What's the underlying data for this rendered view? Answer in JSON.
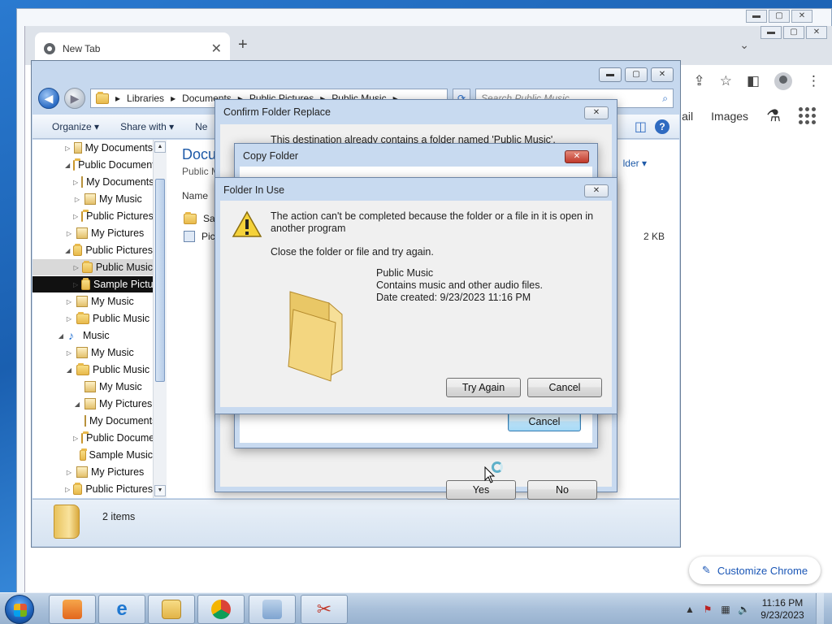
{
  "chrome": {
    "tab_title": "New Tab",
    "links": [
      "ail",
      "Images"
    ],
    "customize_label": "Customize Chrome"
  },
  "explorer": {
    "breadcrumb": [
      "Libraries",
      "Documents",
      "Public Pictures",
      "Public Music"
    ],
    "search_placeholder": "Search Public Music",
    "cmd": {
      "organize": "Organize ▾",
      "share": "Share with ▾",
      "new": "Ne"
    },
    "tree": [
      {
        "label": "My Documents",
        "indent": 1,
        "arrow": "▷",
        "icon": "lib"
      },
      {
        "label": "Public Documents",
        "indent": 1,
        "arrow": "◢",
        "icon": "folder"
      },
      {
        "label": "My Documents",
        "indent": 2,
        "arrow": "▷",
        "icon": "lib"
      },
      {
        "label": "My Music",
        "indent": 2,
        "arrow": "▷",
        "icon": "lib"
      },
      {
        "label": "Public Pictures",
        "indent": 2,
        "arrow": "▷",
        "icon": "folder"
      },
      {
        "label": "My Pictures",
        "indent": 1,
        "arrow": "▷",
        "icon": "lib"
      },
      {
        "label": "Public Pictures",
        "indent": 1,
        "arrow": "◢",
        "icon": "folder"
      },
      {
        "label": "Public Music",
        "indent": 2,
        "arrow": "▷",
        "icon": "folder",
        "state": "sel"
      },
      {
        "label": "Sample Pictures",
        "indent": 2,
        "arrow": "▷",
        "icon": "folder",
        "state": "hl"
      },
      {
        "label": "My Music",
        "indent": 1,
        "arrow": "▷",
        "icon": "lib"
      },
      {
        "label": "Public Music",
        "indent": 1,
        "arrow": "▷",
        "icon": "folder"
      },
      {
        "label": "Music",
        "indent": 0,
        "arrow": "◢",
        "icon": "music"
      },
      {
        "label": "My Music",
        "indent": 1,
        "arrow": "▷",
        "icon": "lib"
      },
      {
        "label": "Public Music",
        "indent": 1,
        "arrow": "◢",
        "icon": "folder"
      },
      {
        "label": "My Music",
        "indent": 2,
        "arrow": "",
        "icon": "lib"
      },
      {
        "label": "My Pictures",
        "indent": 2,
        "arrow": "◢",
        "icon": "lib"
      },
      {
        "label": "My Documents",
        "indent": 3,
        "arrow": "",
        "icon": "lib"
      },
      {
        "label": "Public Documents",
        "indent": 2,
        "arrow": "▷",
        "icon": "folder"
      },
      {
        "label": "Sample Music",
        "indent": 2,
        "arrow": "",
        "icon": "folder"
      },
      {
        "label": "My Pictures",
        "indent": 1,
        "arrow": "▷",
        "icon": "lib"
      },
      {
        "label": "Public Pictures",
        "indent": 1,
        "arrow": "▷",
        "icon": "folder"
      }
    ],
    "heading": "Docu",
    "sub": "Public M",
    "arrange": "lder ▾",
    "col_name": "Name",
    "rows": [
      {
        "name": "Sam",
        "size": ""
      },
      {
        "name": "Pict",
        "size": "2 KB"
      }
    ],
    "status": "2 items"
  },
  "confirm_dialog": {
    "title": "Confirm Folder Replace",
    "message": "This destination already contains a folder named 'Public Music'.",
    "yes": "Yes",
    "no": "No"
  },
  "copy_dialog": {
    "title": "Copy Folder",
    "cancel": "Cancel"
  },
  "in_use_dialog": {
    "title": "Folder In Use",
    "message1": "The action can't be completed because the folder or a file in it is open in another program",
    "message2": "Close the folder or file and try again.",
    "item_name": "Public Music",
    "item_desc": "Contains music and other audio files.",
    "item_date": "Date created: 9/23/2023 11:16 PM",
    "try_again": "Try Again",
    "cancel": "Cancel"
  },
  "taskbar": {
    "time": "11:16 PM",
    "date": "9/23/2023"
  },
  "colors": {
    "accent": "#1e5aa8",
    "dialog_frame": "#c8daf0",
    "taskbar": "#a9c0da"
  }
}
